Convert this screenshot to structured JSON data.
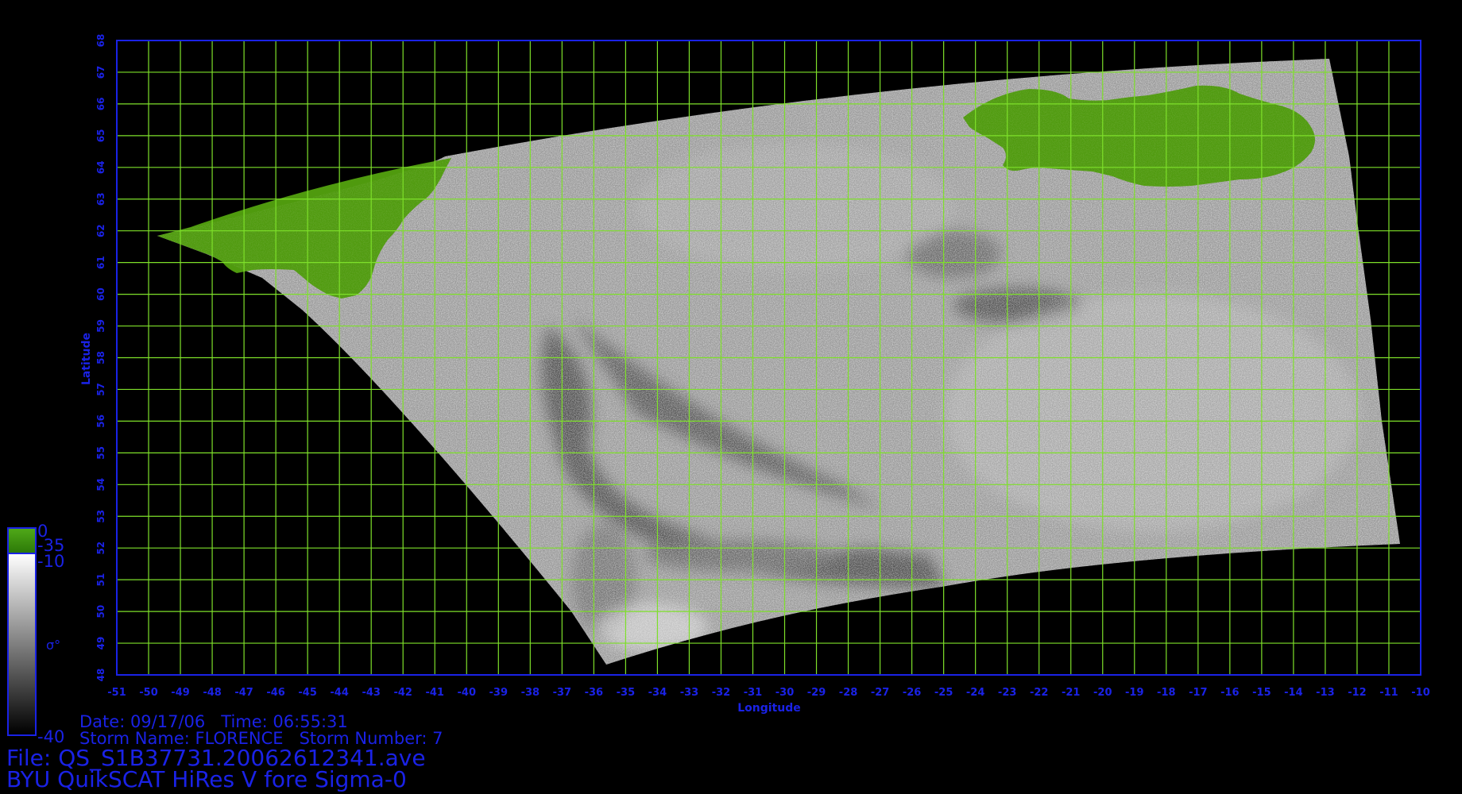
{
  "map": {
    "lon_range": [
      -51,
      -10
    ],
    "lat_range": [
      48,
      68
    ],
    "x_label": "Longitude",
    "y_label": "Latitude",
    "grid_step_deg": 1,
    "grid_color": "#7ee02a",
    "frame_color": "#1a22e6",
    "label_color": "#1a22e6",
    "land_color": "#4f9a0e",
    "swath_shade": "#9a9a9a",
    "background": "#000000"
  },
  "colorbar": {
    "symbol": "σ°",
    "labels": {
      "top": "0",
      "land_bottom": "-35",
      "sigma_top": "-10",
      "bottom": "-40"
    },
    "green_segment_color": "#55a81a",
    "white_color": "#ffffff",
    "black_color": "#000000"
  },
  "info": {
    "date_line": "Date: 09/17/06   Time: 06:55:31",
    "storm_line": "Storm Name: FLORENCE   Storm Number: 7",
    "file_line": "File: QS_S1B37731.20062612341.ave",
    "title_line": "BYU QuikSCAT HiRes V fore Sigma-0"
  }
}
